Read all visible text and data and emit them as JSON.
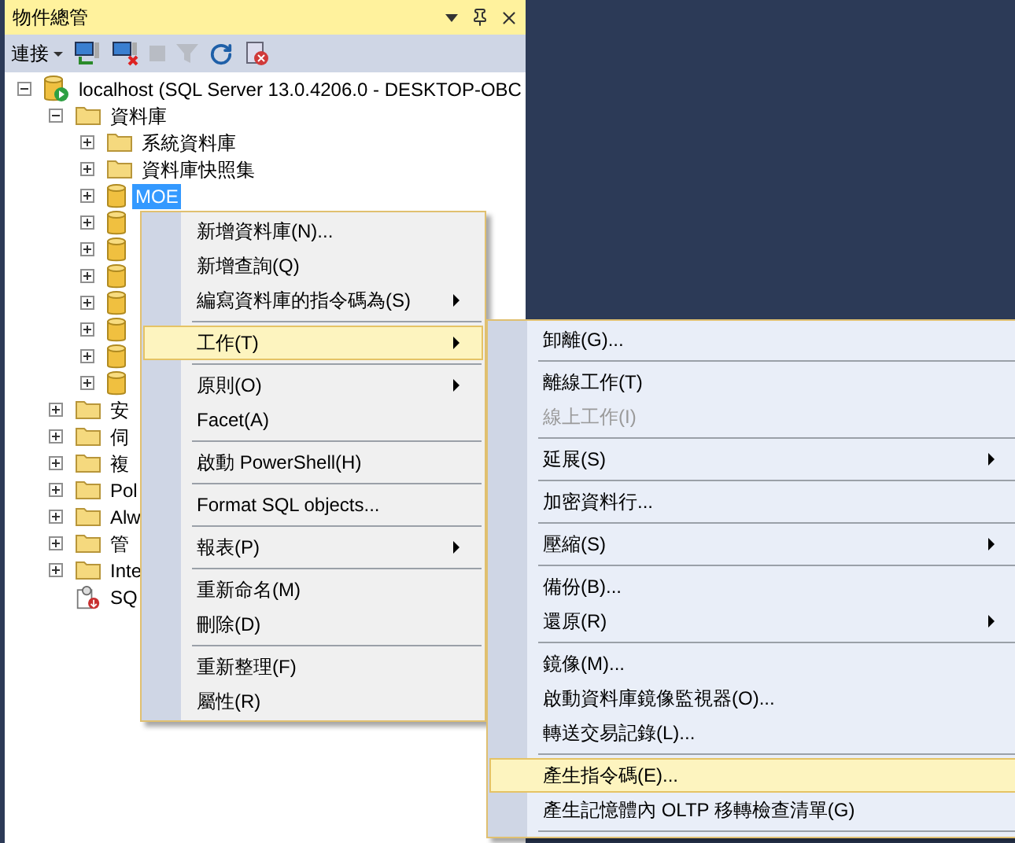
{
  "panel": {
    "title": "物件總管",
    "toolbar": {
      "connect": "連接"
    }
  },
  "tree": [
    {
      "label": "localhost (SQL Server 13.0.4206.0 - DESKTOP-OBC",
      "kind": "server",
      "expanded": true,
      "selected": false,
      "children": [
        {
          "label": "資料庫",
          "kind": "folder",
          "expanded": true,
          "selected": false,
          "children": [
            {
              "label": "系統資料庫",
              "kind": "folder",
              "expanded": false,
              "selected": false
            },
            {
              "label": "資料庫快照集",
              "kind": "folder",
              "expanded": false,
              "selected": false
            },
            {
              "label": "MOE",
              "kind": "database",
              "expanded": false,
              "selected": true
            },
            {
              "kind": "database",
              "expanded": false,
              "selected": false
            },
            {
              "kind": "database",
              "expanded": false,
              "selected": false
            },
            {
              "kind": "database",
              "expanded": false,
              "selected": false
            },
            {
              "kind": "database",
              "expanded": false,
              "selected": false
            },
            {
              "kind": "database",
              "expanded": false,
              "selected": false
            },
            {
              "kind": "database",
              "expanded": false,
              "selected": false
            },
            {
              "kind": "database",
              "expanded": false,
              "selected": false
            }
          ]
        },
        {
          "label": "安",
          "kind": "folder",
          "expanded": false,
          "selected": false
        },
        {
          "label": "伺",
          "kind": "folder",
          "expanded": false,
          "selected": false
        },
        {
          "label": "複",
          "kind": "folder",
          "expanded": false,
          "selected": false
        },
        {
          "label": "Pol",
          "kind": "folder",
          "expanded": false,
          "selected": false
        },
        {
          "label": "Alw",
          "kind": "folder",
          "expanded": false,
          "selected": false
        },
        {
          "label": "管",
          "kind": "folder",
          "expanded": false,
          "selected": false
        },
        {
          "label": "Inte",
          "kind": "folder",
          "expanded": false,
          "selected": false
        },
        {
          "label": "SQ",
          "kind": "agent",
          "selected": false
        }
      ]
    }
  ],
  "context_menu": [
    {
      "kind": "item",
      "label": "新增資料庫(N)...",
      "selected": false,
      "submenu": false
    },
    {
      "kind": "item",
      "label": "新增查詢(Q)",
      "selected": false,
      "submenu": false
    },
    {
      "kind": "item",
      "label": "編寫資料庫的指令碼為(S)",
      "selected": false,
      "submenu": true
    },
    {
      "kind": "separator"
    },
    {
      "kind": "item",
      "label": "工作(T)",
      "selected": true,
      "submenu": true
    },
    {
      "kind": "separator"
    },
    {
      "kind": "item",
      "label": "原則(O)",
      "selected": false,
      "submenu": true
    },
    {
      "kind": "item",
      "label": "Facet(A)",
      "selected": false,
      "submenu": false
    },
    {
      "kind": "separator"
    },
    {
      "kind": "item",
      "label": "啟動 PowerShell(H)",
      "selected": false,
      "submenu": false
    },
    {
      "kind": "separator"
    },
    {
      "kind": "item",
      "label": "Format SQL objects...",
      "selected": false,
      "submenu": false
    },
    {
      "kind": "separator"
    },
    {
      "kind": "item",
      "label": "報表(P)",
      "selected": false,
      "submenu": true
    },
    {
      "kind": "separator"
    },
    {
      "kind": "item",
      "label": "重新命名(M)",
      "selected": false,
      "submenu": false
    },
    {
      "kind": "item",
      "label": "刪除(D)",
      "selected": false,
      "submenu": false
    },
    {
      "kind": "separator"
    },
    {
      "kind": "item",
      "label": "重新整理(F)",
      "selected": false,
      "submenu": false
    },
    {
      "kind": "item",
      "label": "屬性(R)",
      "selected": false,
      "submenu": false
    }
  ],
  "tasks_submenu": [
    {
      "kind": "item",
      "label": "卸離(G)...",
      "selected": false,
      "disabled": false,
      "submenu": false
    },
    {
      "kind": "separator"
    },
    {
      "kind": "item",
      "label": "離線工作(T)",
      "selected": false,
      "disabled": false,
      "submenu": false
    },
    {
      "kind": "item",
      "label": "線上工作(I)",
      "selected": false,
      "disabled": true,
      "submenu": false
    },
    {
      "kind": "separator"
    },
    {
      "kind": "item",
      "label": "延展(S)",
      "selected": false,
      "disabled": false,
      "submenu": true
    },
    {
      "kind": "separator"
    },
    {
      "kind": "item",
      "label": "加密資料行...",
      "selected": false,
      "disabled": false,
      "submenu": false
    },
    {
      "kind": "separator"
    },
    {
      "kind": "item",
      "label": "壓縮(S)",
      "selected": false,
      "disabled": false,
      "submenu": true
    },
    {
      "kind": "separator"
    },
    {
      "kind": "item",
      "label": "備份(B)...",
      "selected": false,
      "disabled": false,
      "submenu": false
    },
    {
      "kind": "item",
      "label": "還原(R)",
      "selected": false,
      "disabled": false,
      "submenu": true
    },
    {
      "kind": "separator"
    },
    {
      "kind": "item",
      "label": "鏡像(M)...",
      "selected": false,
      "disabled": false,
      "submenu": false
    },
    {
      "kind": "item",
      "label": "啟動資料庫鏡像監視器(O)...",
      "selected": false,
      "disabled": false,
      "submenu": false
    },
    {
      "kind": "item",
      "label": "轉送交易記錄(L)...",
      "selected": false,
      "disabled": false,
      "submenu": false
    },
    {
      "kind": "separator"
    },
    {
      "kind": "item",
      "label": "產生指令碼(E)...",
      "selected": true,
      "disabled": false,
      "submenu": false
    },
    {
      "kind": "item",
      "label": "產生記憶體內 OLTP 移轉檢查清單(G)",
      "selected": false,
      "disabled": false,
      "submenu": false
    },
    {
      "kind": "separator"
    }
  ]
}
